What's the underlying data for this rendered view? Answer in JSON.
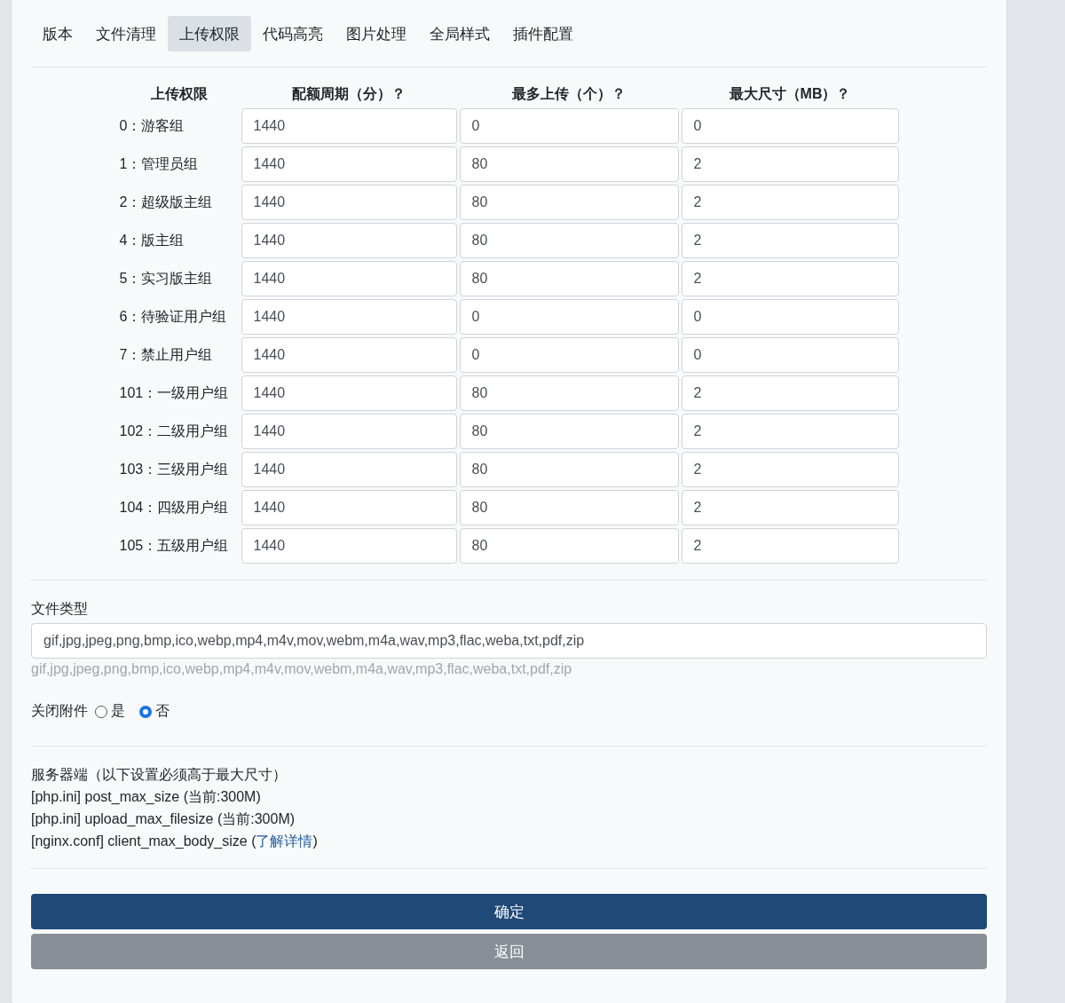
{
  "tabs": [
    {
      "label": "版本",
      "selected": false
    },
    {
      "label": "文件清理",
      "selected": false
    },
    {
      "label": "上传权限",
      "selected": true
    },
    {
      "label": "代码高亮",
      "selected": false
    },
    {
      "label": "图片处理",
      "selected": false
    },
    {
      "label": "全局样式",
      "selected": false
    },
    {
      "label": "插件配置",
      "selected": false
    }
  ],
  "table": {
    "columns": [
      "上传权限",
      "配额周期（分）？",
      "最多上传（个）？",
      "最大尺寸（MB）？"
    ],
    "rows": [
      {
        "group": "0：游客组",
        "values": [
          "1440",
          "0",
          "0"
        ]
      },
      {
        "group": "1：管理员组",
        "values": [
          "1440",
          "80",
          "2"
        ]
      },
      {
        "group": "2：超级版主组",
        "values": [
          "1440",
          "80",
          "2"
        ]
      },
      {
        "group": "4：版主组",
        "values": [
          "1440",
          "80",
          "2"
        ]
      },
      {
        "group": "5：实习版主组",
        "values": [
          "1440",
          "80",
          "2"
        ]
      },
      {
        "group": "6：待验证用户组",
        "values": [
          "1440",
          "0",
          "0"
        ]
      },
      {
        "group": "7：禁止用户组",
        "values": [
          "1440",
          "0",
          "0"
        ]
      },
      {
        "group": "101：一级用户组",
        "values": [
          "1440",
          "80",
          "2"
        ]
      },
      {
        "group": "102：二级用户组",
        "values": [
          "1440",
          "80",
          "2"
        ]
      },
      {
        "group": "103：三级用户组",
        "values": [
          "1440",
          "80",
          "2"
        ]
      },
      {
        "group": "104：四级用户组",
        "values": [
          "1440",
          "80",
          "2"
        ]
      },
      {
        "group": "105：五级用户组",
        "values": [
          "1440",
          "80",
          "2"
        ]
      }
    ]
  },
  "file_types": {
    "label": "文件类型",
    "value": "gif,jpg,jpeg,png,bmp,ico,webp,mp4,m4v,mov,webm,m4a,wav,mp3,flac,weba,txt,pdf,zip",
    "hint": "gif,jpg,jpeg,png,bmp,ico,webp,mp4,m4v,mov,webm,m4a,wav,mp3,flac,weba,txt,pdf,zip"
  },
  "close_attachments": {
    "label": "关闭附件",
    "options": [
      {
        "label": "是",
        "selected": false
      },
      {
        "label": "否",
        "selected": true
      }
    ]
  },
  "server": {
    "title": "服务器端（以下设置必须高于最大尺寸）",
    "lines": [
      "[php.ini] post_max_size (当前:300M)",
      "[php.ini] upload_max_filesize (当前:300M)"
    ],
    "last_line": {
      "text": "[nginx.conf] client_max_body_size (",
      "link": "了解详情",
      "suffix": ")"
    }
  },
  "buttons": [
    {
      "label": "确定",
      "kind": "primary"
    },
    {
      "label": "返回",
      "kind": "secondary"
    }
  ]
}
